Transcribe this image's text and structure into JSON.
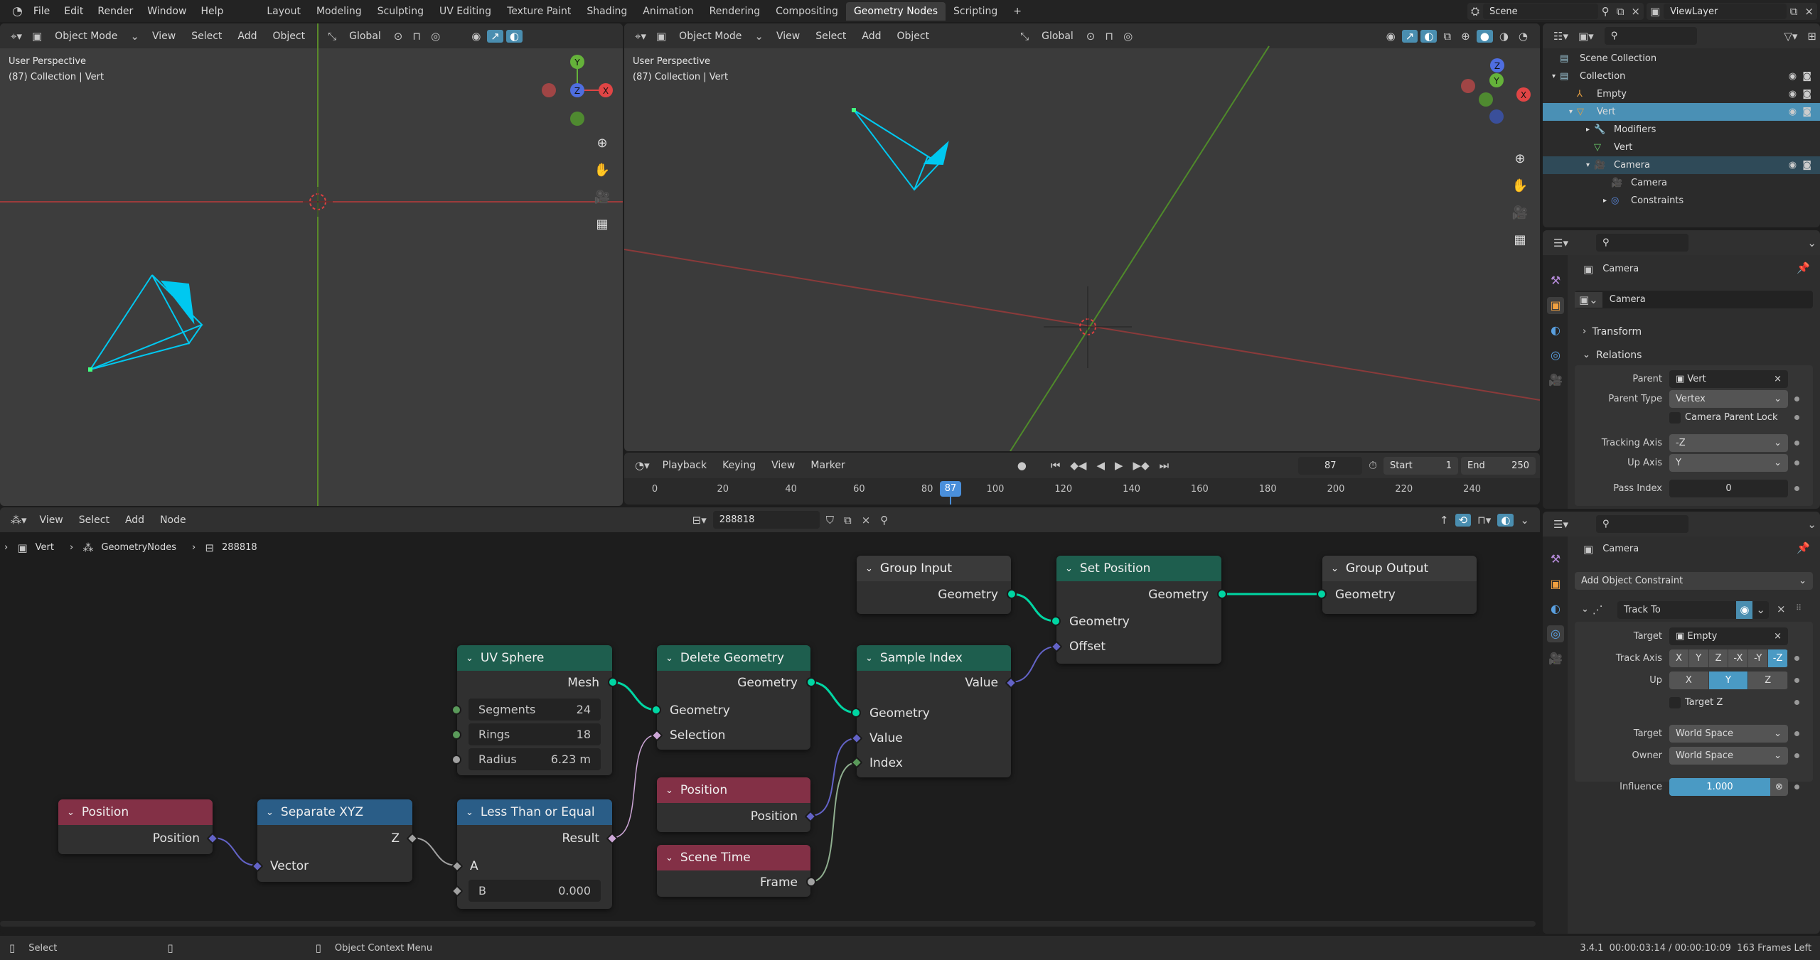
{
  "topbar": {
    "menus": [
      "File",
      "Edit",
      "Render",
      "Window",
      "Help"
    ],
    "workspaces": [
      "Layout",
      "Modeling",
      "Sculpting",
      "UV Editing",
      "Texture Paint",
      "Shading",
      "Animation",
      "Rendering",
      "Compositing",
      "Geometry Nodes",
      "Scripting"
    ],
    "active_workspace": "Geometry Nodes",
    "add_tab": "+",
    "scene": "Scene",
    "view_layer": "ViewLayer"
  },
  "viewport_left": {
    "mode": "Object Mode",
    "menus": [
      "View",
      "Select",
      "Add",
      "Object"
    ],
    "orientation": "Global",
    "overlay_title": "User Perspective",
    "overlay_sub": "(87) Collection | Vert"
  },
  "viewport_right": {
    "mode": "Object Mode",
    "menus": [
      "View",
      "Select",
      "Add",
      "Object"
    ],
    "orientation": "Global",
    "overlay_title": "User Perspective",
    "overlay_sub": "(87) Collection | Vert"
  },
  "gizmo": {
    "x": "X",
    "y": "Y",
    "z": "Z"
  },
  "timeline": {
    "menus": [
      "Playback",
      "Keying",
      "View",
      "Marker"
    ],
    "current_frame": "87",
    "start_label": "Start",
    "start": "1",
    "end_label": "End",
    "end": "250",
    "ticks": [
      "0",
      "20",
      "40",
      "60",
      "80",
      "100",
      "120",
      "140",
      "160",
      "180",
      "200",
      "220",
      "240"
    ]
  },
  "outliner": {
    "items": [
      {
        "label": "Scene Collection",
        "icon": "collection-icon"
      },
      {
        "label": "Collection",
        "icon": "collection-icon"
      },
      {
        "label": "Empty",
        "icon": "empty-icon"
      },
      {
        "label": "Vert",
        "icon": "mesh-object-icon",
        "selected": true
      },
      {
        "label": "Modifiers",
        "icon": "wrench-icon"
      },
      {
        "label": "Vert",
        "icon": "mesh-data-icon"
      },
      {
        "label": "Camera",
        "icon": "camera-object-icon",
        "active": true
      },
      {
        "label": "Camera",
        "icon": "camera-data-icon"
      },
      {
        "label": "Constraints",
        "icon": "constraint-icon"
      }
    ]
  },
  "props_object": {
    "object": "Camera",
    "datablock": "Camera",
    "transform": "Transform",
    "relations": "Relations",
    "parent_label": "Parent",
    "parent": "Vert",
    "parent_type_label": "Parent Type",
    "parent_type": "Vertex",
    "camera_parent_lock": "Camera Parent Lock",
    "tracking_axis_label": "Tracking Axis",
    "tracking_axis": "-Z",
    "up_axis_label": "Up Axis",
    "up_axis": "Y",
    "pass_index_label": "Pass Index",
    "pass_index": "0"
  },
  "props_constraint": {
    "object": "Camera",
    "add_constraint": "Add Object Constraint",
    "constraint_name": "Track To",
    "target_label": "Target",
    "target": "Empty",
    "track_axis_label": "Track Axis",
    "track_axis_options": [
      "X",
      "Y",
      "Z",
      "-X",
      "-Y",
      "-Z"
    ],
    "track_axis_selected": "-Z",
    "up_label": "Up",
    "up_options": [
      "X",
      "Y",
      "Z"
    ],
    "up_selected": "Y",
    "target_z": "Target Z",
    "target_space_label": "Target",
    "target_space": "World Space",
    "owner_space_label": "Owner",
    "owner_space": "World Space",
    "influence_label": "Influence",
    "influence": "1.000"
  },
  "node_editor": {
    "menus": [
      "View",
      "Select",
      "Add",
      "Node"
    ],
    "node_tree": "288818",
    "breadcrumb": [
      "Vert",
      "GeometryNodes",
      "288818"
    ]
  },
  "nodes": {
    "group_input": {
      "title": "Group Input",
      "outputs": [
        "Geometry"
      ]
    },
    "set_position": {
      "title": "Set Position",
      "outputs": [
        "Geometry"
      ],
      "inputs": [
        "Geometry",
        "Offset"
      ]
    },
    "group_output": {
      "title": "Group Output",
      "inputs": [
        "Geometry"
      ]
    },
    "uv_sphere": {
      "title": "UV Sphere",
      "outputs": [
        "Mesh"
      ],
      "fields": [
        {
          "label": "Segments",
          "value": "24"
        },
        {
          "label": "Rings",
          "value": "18"
        },
        {
          "label": "Radius",
          "value": "6.23 m"
        }
      ]
    },
    "delete_geometry": {
      "title": "Delete Geometry",
      "outputs": [
        "Geometry"
      ],
      "inputs": [
        "Geometry",
        "Selection"
      ]
    },
    "sample_index": {
      "title": "Sample Index",
      "outputs": [
        "Value"
      ],
      "inputs": [
        "Geometry",
        "Value",
        "Index"
      ]
    },
    "position_mid": {
      "title": "Position",
      "outputs": [
        "Position"
      ]
    },
    "scene_time": {
      "title": "Scene Time",
      "outputs": [
        "Frame"
      ]
    },
    "position_left": {
      "title": "Position",
      "outputs": [
        "Position"
      ]
    },
    "separate_xyz": {
      "title": "Separate XYZ",
      "outputs": [
        "Z"
      ],
      "inputs": [
        "Vector"
      ]
    },
    "less_equal": {
      "title": "Less Than or Equal",
      "outputs": [
        "Result"
      ],
      "inputs": [
        "A"
      ],
      "b_label": "B",
      "b_value": "0.000"
    }
  },
  "statusbar": {
    "select": "Select",
    "context_menu": "Object Context Menu",
    "info": "3.4.1  00:00:03:14 / 00:00:10:09  163 Frames Left"
  },
  "colors": {
    "accent": "#4a9ac4",
    "geometry_socket": "#00d6a3",
    "vector_socket": "#6363c7",
    "boolean_socket": "#cca6d6",
    "geometry_node_header": "#1e5e4e",
    "input_node_header": "#833046",
    "converter_node_header": "#2a5d87",
    "camera_wire": "#00c8f0",
    "frame_indicator": "#4a8fdb"
  }
}
